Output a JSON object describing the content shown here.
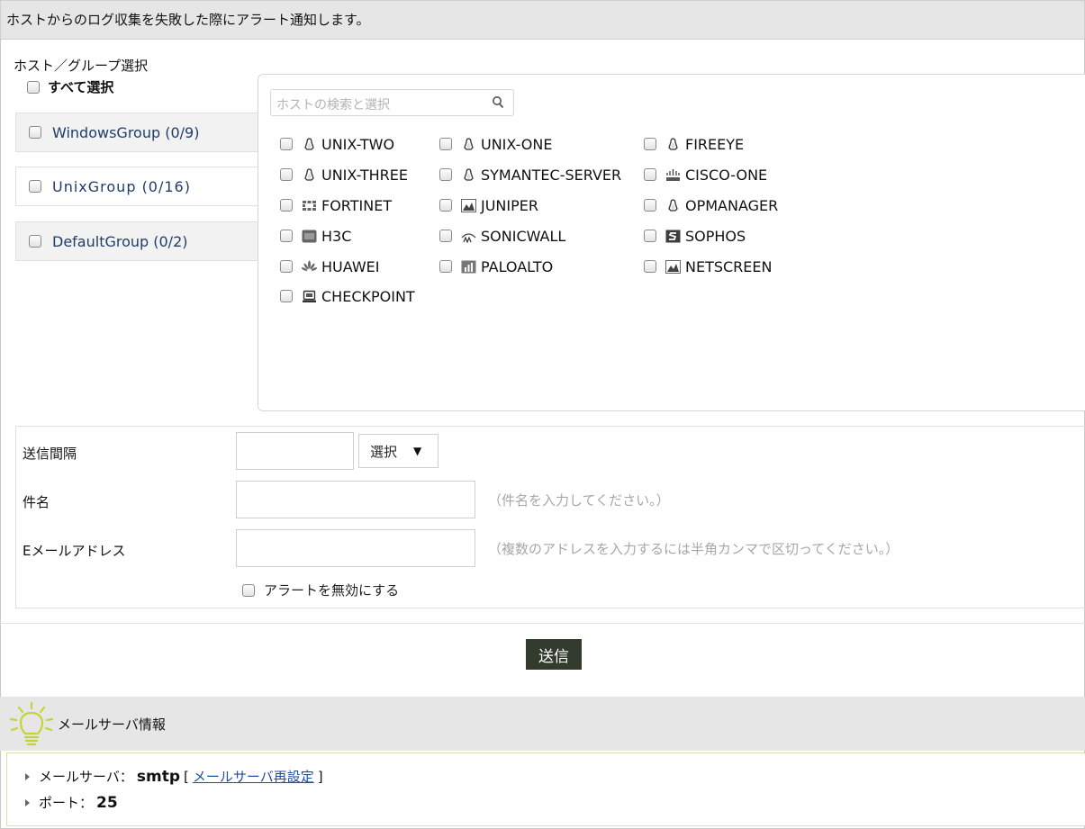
{
  "header": {
    "title": "ホストからのログ収集を失敗した際にアラート通知します。"
  },
  "selector": {
    "title": "ホスト／グループ選択",
    "select_all": "すべて選択",
    "groups": [
      {
        "label": "WindowsGroup (0/9)"
      },
      {
        "label": "UnixGroup (0/16)"
      },
      {
        "label": "DefaultGroup (0/2)"
      }
    ],
    "search_placeholder": "ホストの検索と選択",
    "hosts": [
      {
        "label": "UNIX-TWO",
        "icon": "linux-icon"
      },
      {
        "label": "UNIX-ONE",
        "icon": "linux-icon"
      },
      {
        "label": "FIREEYE",
        "icon": "linux-icon"
      },
      {
        "label": "UNIX-THREE",
        "icon": "linux-icon"
      },
      {
        "label": "SYMANTEC-SERVER",
        "icon": "linux-icon"
      },
      {
        "label": "CISCO-ONE",
        "icon": "cisco-icon"
      },
      {
        "label": "FORTINET",
        "icon": "fortinet-icon"
      },
      {
        "label": "JUNIPER",
        "icon": "juniper-icon"
      },
      {
        "label": "OPMANAGER",
        "icon": "linux-icon"
      },
      {
        "label": "H3C",
        "icon": "h3c-icon"
      },
      {
        "label": "SONICWALL",
        "icon": "sonicwall-icon"
      },
      {
        "label": "SOPHOS",
        "icon": "sophos-icon"
      },
      {
        "label": "HUAWEI",
        "icon": "huawei-icon"
      },
      {
        "label": "PALOALTO",
        "icon": "paloalto-icon"
      },
      {
        "label": "NETSCREEN",
        "icon": "netscreen-icon"
      },
      {
        "label": "CHECKPOINT",
        "icon": "checkpoint-icon"
      }
    ]
  },
  "form": {
    "interval_label": "送信間隔",
    "interval_value": "",
    "interval_select": "選択",
    "subject_label": "件名",
    "subject_value": "",
    "subject_hint": "（件名を入力してください。）",
    "email_label": "Eメールアドレス",
    "email_value": "",
    "email_hint": "（複数のアドレスを入力するには半角カンマで区切ってください。）",
    "disable_alert": "アラートを無効にする",
    "submit": "送信"
  },
  "mail_info": {
    "title": "メールサーバ情報",
    "server_label": "メールサーバ：",
    "server_value": "smtp",
    "reconfig_link": "メールサーバ再設定",
    "bracket_open": "[",
    "bracket_close": "]",
    "port_label": "ポート：",
    "port_value": "25"
  },
  "colors": {
    "send_button": "#333a2e",
    "group_text": "#1f3e6a",
    "link": "#1f4fa0",
    "bulb": "#c3d43a"
  }
}
